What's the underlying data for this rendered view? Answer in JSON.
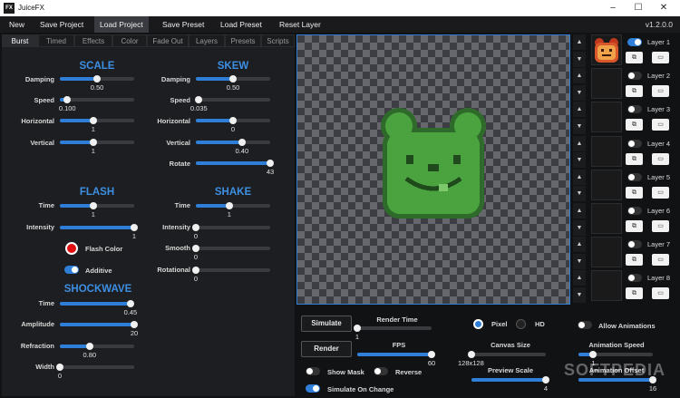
{
  "window": {
    "title": "JuiceFX",
    "icon_text": "FX",
    "version": "v1.2.0.0"
  },
  "menu": [
    "New",
    "Save Project",
    "Load Project",
    "Save Preset",
    "Load Preset",
    "Reset Layer"
  ],
  "tabs": [
    "Burst",
    "Timed",
    "Effects",
    "Color",
    "Fade Out",
    "Layers",
    "Presets",
    "Scripts"
  ],
  "scale": {
    "heading": "SCALE",
    "damping": {
      "label": "Damping",
      "value": "0.50",
      "level": 0.5
    },
    "speed": {
      "label": "Speed",
      "value": "0.100",
      "level": 0.1
    },
    "horizontal": {
      "label": "Horizontal",
      "value": "1",
      "level": 0.45
    },
    "vertical": {
      "label": "Vertical",
      "value": "1",
      "level": 0.45
    }
  },
  "skew": {
    "heading": "SKEW",
    "damping": {
      "label": "Damping",
      "value": "0.50",
      "level": 0.5
    },
    "speed": {
      "label": "Speed",
      "value": "0.035",
      "level": 0.04
    },
    "horizontal": {
      "label": "Horizontal",
      "value": "0",
      "level": 0.5
    },
    "vertical": {
      "label": "Vertical",
      "value": "0.40",
      "level": 0.62
    },
    "rotate": {
      "label": "Rotate",
      "value": "43",
      "level": 1.0
    }
  },
  "flash": {
    "heading": "FLASH",
    "time": {
      "label": "Time",
      "value": "1",
      "level": 0.45
    },
    "intensity": {
      "label": "Intensity",
      "value": "1",
      "level": 1.0
    },
    "flash_color_label": "Flash Color",
    "flash_color": "#e01010",
    "additive_label": "Additive"
  },
  "shake": {
    "heading": "SHAKE",
    "time": {
      "label": "Time",
      "value": "1",
      "level": 0.45
    },
    "intensity": {
      "label": "Intensity",
      "value": "0",
      "level": 0.0
    },
    "smooth": {
      "label": "Smooth",
      "value": "0",
      "level": 0.0
    },
    "rotational": {
      "label": "Rotational",
      "value": "0",
      "level": 0.0
    }
  },
  "shockwave": {
    "heading": "SHOCKWAVE",
    "time": {
      "label": "Time",
      "value": "0.45",
      "level": 0.95
    },
    "amplitude": {
      "label": "Amplitude",
      "value": "20",
      "level": 1.0
    },
    "refraction": {
      "label": "Refraction",
      "value": "0.80",
      "level": 0.4
    },
    "width": {
      "label": "Width",
      "value": "0",
      "level": 0.0
    }
  },
  "layers": [
    {
      "label": "Layer 1",
      "on": true
    },
    {
      "label": "Layer 2",
      "on": false
    },
    {
      "label": "Layer 3",
      "on": false
    },
    {
      "label": "Layer 4",
      "on": false
    },
    {
      "label": "Layer 5",
      "on": false
    },
    {
      "label": "Layer 6",
      "on": false
    },
    {
      "label": "Layer 7",
      "on": false
    },
    {
      "label": "Layer 8",
      "on": false
    }
  ],
  "bottom": {
    "simulate_button": "Simulate",
    "render_button": "Render",
    "render_time": {
      "label": "Render Time",
      "value": "1",
      "level": 0.0
    },
    "fps": {
      "label": "FPS",
      "value": "60",
      "level": 1.0
    },
    "show_mask_label": "Show Mask",
    "reverse_label": "Reverse",
    "simulate_on_change_label": "Simulate On Change",
    "pixel_label": "Pixel",
    "hd_label": "HD",
    "canvas_size": {
      "label": "Canvas Size",
      "value": "128x128",
      "level": 0.0
    },
    "preview_scale": {
      "label": "Preview Scale",
      "value": "4",
      "level": 1.0
    },
    "allow_animations_label": "Allow Animations",
    "animation_speed": {
      "label": "Animation Speed",
      "value": "1",
      "level": 0.2
    },
    "animation_offset": {
      "label": "Animation Offset",
      "value": "16",
      "level": 1.0
    }
  },
  "watermark": "SOFTPEDIA",
  "colors": {
    "accent": "#2f7fd8",
    "panel": "#1d1e21",
    "bear_dark": "#2e6b2a",
    "bear_light": "#4aa33f"
  }
}
